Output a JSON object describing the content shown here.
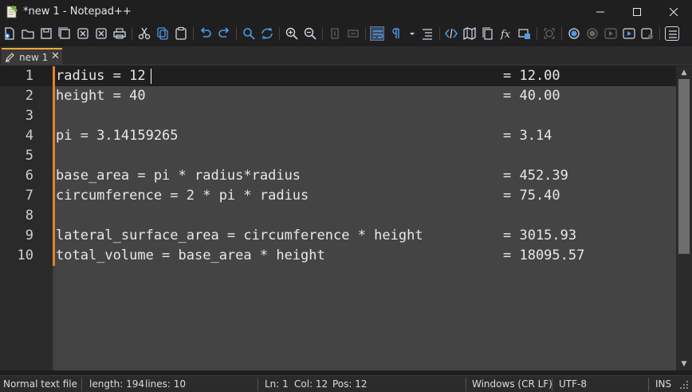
{
  "window": {
    "title": "*new 1 - Notepad++",
    "minimize_icon": "minimize-icon",
    "maximize_icon": "maximize-icon",
    "close_icon": "close-icon"
  },
  "toolbar": {
    "buttons": [
      "new-file-icon",
      "open-file-icon",
      "save-icon",
      "save-all-icon",
      "close-icon",
      "close-all-icon",
      "print-icon",
      "cut-icon",
      "copy-icon",
      "paste-icon",
      "undo-icon",
      "redo-icon",
      "find-icon",
      "replace-icon",
      "zoom-in-icon",
      "zoom-out-icon",
      "sync-vertical-icon",
      "sync-horizontal-icon",
      "word-wrap-icon",
      "show-all-chars-icon",
      "indent-guide-icon",
      "udl-icon",
      "doc-map-icon",
      "doc-list-icon",
      "function-list-icon",
      "folder-workspace-icon",
      "monitoring-icon",
      "record-macro-icon",
      "stop-macro-icon",
      "play-macro-icon",
      "run-macro-multiple-icon",
      "save-macro-icon",
      "panel-toggle-icon"
    ]
  },
  "tabs": [
    {
      "label": "new 1",
      "close": "✕",
      "active": true
    }
  ],
  "editor": {
    "lines": [
      {
        "number": "1",
        "code": "radius = 12",
        "result": "= 12.00"
      },
      {
        "number": "2",
        "code": "height = 40",
        "result": "= 40.00"
      },
      {
        "number": "3",
        "code": "",
        "result": ""
      },
      {
        "number": "4",
        "code": "pi = 3.14159265",
        "result": "= 3.14"
      },
      {
        "number": "5",
        "code": "",
        "result": ""
      },
      {
        "number": "6",
        "code": "base_area = pi * radius*radius",
        "result": "= 452.39"
      },
      {
        "number": "7",
        "code": "circumference = 2 * pi * radius",
        "result": "= 75.40"
      },
      {
        "number": "8",
        "code": "",
        "result": ""
      },
      {
        "number": "9",
        "code": "lateral_surface_area = circumference * height",
        "result": "= 3015.93"
      },
      {
        "number": "10",
        "code": "total_volume = base_area * height",
        "result": "= 18095.57"
      }
    ]
  },
  "status": {
    "language": "Normal text file",
    "length": "length: 194",
    "lines": "lines: 10",
    "ln": "Ln: 1",
    "col": "Col: 12",
    "pos": "Pos: 12",
    "eol": "Windows (CR LF)",
    "encoding": "UTF-8",
    "mode": "INS"
  },
  "colors": {
    "change_marker": "#e48223",
    "tab_accent": "#f1a53c",
    "editor_bg": "#444444",
    "current_line_bg": "#1f1f1f"
  }
}
